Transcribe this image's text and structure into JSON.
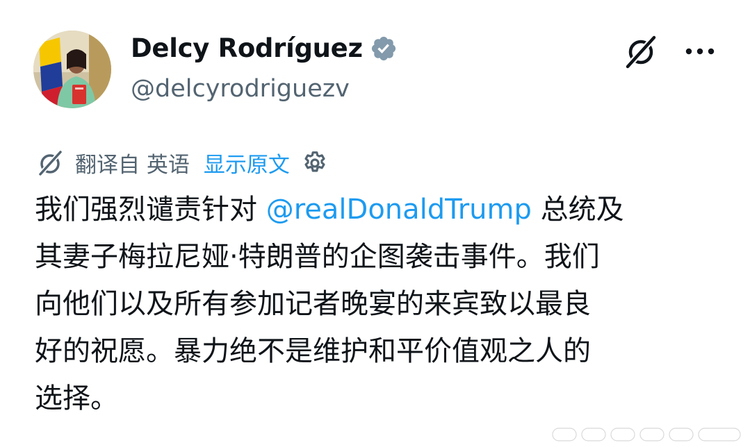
{
  "author": {
    "display_name": "Delcy Rodríguez",
    "handle": "@delcyrodriguezv",
    "verified_icon": "verified-badge-icon"
  },
  "header_actions": {
    "grok_icon": "grok-slash-icon",
    "more_icon": "more-horizontal-icon"
  },
  "translation": {
    "translated_from": "翻译自 英语",
    "show_original": "显示原文",
    "settings_icon": "gear-icon"
  },
  "tweet": {
    "line1_before": "我们强烈谴责针对 ",
    "mention": "@realDonaldTrump",
    "line1_after": " 总统及",
    "line2": "其妻子梅拉尼娅·特朗普的企图袭击事件。我们",
    "line3": "向他们以及所有参加记者晚宴的来宾致以最良",
    "line4": "好的祝愿。暴力绝不是维护和平价值观之人的",
    "line5": "选择。"
  },
  "colors": {
    "text": "#0f1419",
    "secondary": "#536471",
    "link": "#1d9bf0",
    "verified_badge": "#829aab"
  }
}
